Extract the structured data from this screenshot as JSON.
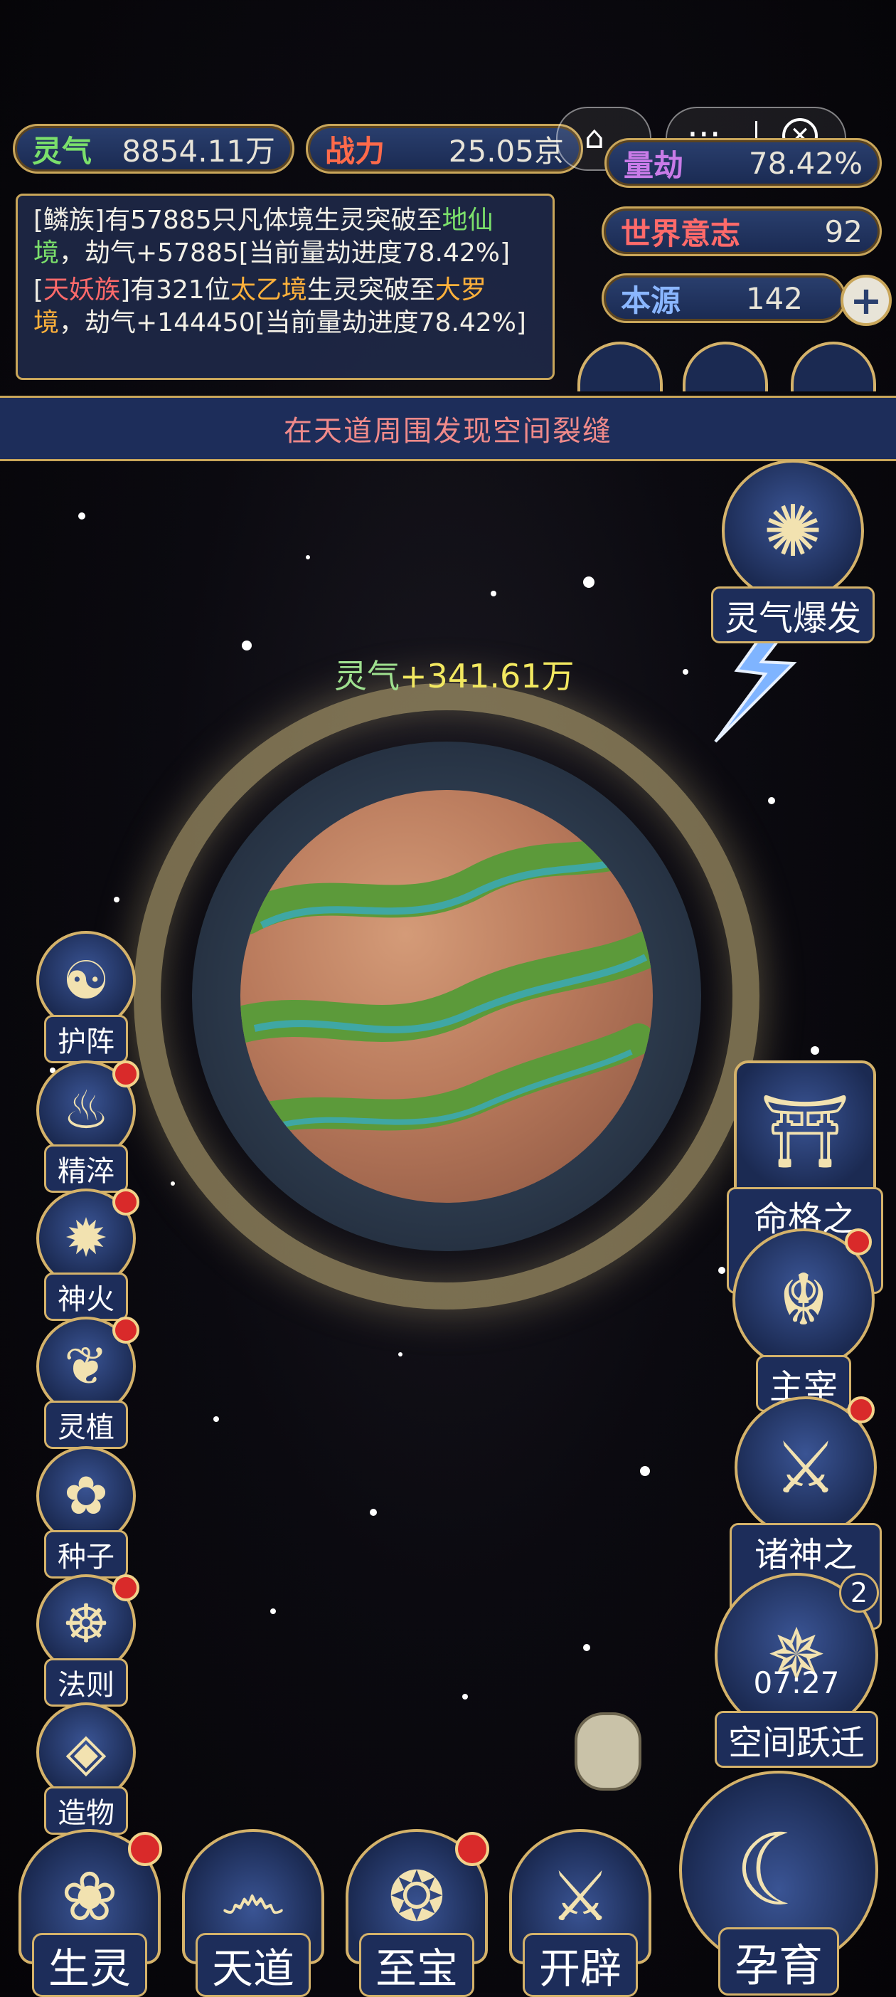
{
  "stats": {
    "lingqi": {
      "label": "灵气",
      "value": "8854.11万"
    },
    "zhanli": {
      "label": "战力",
      "value": "25.05京"
    },
    "liangjie": {
      "label": "量劫",
      "value": "78.42%"
    },
    "world_will": {
      "label": "世界意志",
      "value": "92"
    },
    "origin": {
      "label": "本源",
      "value": "142",
      "plus": "+"
    }
  },
  "log": {
    "line1_prefix": "[鳞族]有57885只凡体境生灵突破至",
    "line1_realm": "地仙境",
    "line1_suffix": "，劫气+57885[当前量劫进度78.42%]",
    "line2_open": "[",
    "line2_clan": "天妖族",
    "line2_mid": "]有321位",
    "line2_realm1": "太乙境",
    "line2_mid2": "生灵突破至",
    "line2_realm2": "大罗境",
    "line2_suffix": "，劫气+144450[当前量劫进度78.42%]"
  },
  "banner": "在天道周围发现空间裂缝",
  "gain": {
    "label": "灵气",
    "value": "+341.61万"
  },
  "left_buttons": [
    {
      "label": "护阵",
      "icon": "yin-yang-icon",
      "glyph": "☯"
    },
    {
      "label": "精淬",
      "icon": "flame-lotus-icon",
      "glyph": "♨"
    },
    {
      "label": "神火",
      "icon": "fire-icon",
      "glyph": "✹"
    },
    {
      "label": "灵植",
      "icon": "plant-icon",
      "glyph": "❦"
    },
    {
      "label": "种子",
      "icon": "seed-flower-icon",
      "glyph": "✿"
    },
    {
      "label": "法则",
      "icon": "rule-beast-icon",
      "glyph": "☸"
    },
    {
      "label": "造物",
      "icon": "rune-diamond-icon",
      "glyph": "◈"
    }
  ],
  "right_buttons": {
    "burst": "灵气爆发",
    "fate": "命格之门",
    "master": "主宰",
    "war": "诸神之战",
    "jump": "空间跃迁",
    "jump_timer": "07:27",
    "jump_badge": "2"
  },
  "bottom_nav": [
    {
      "label": "生灵",
      "icon": "phoenix-icon",
      "glyph": "❀"
    },
    {
      "label": "天道",
      "icon": "swirl-icon",
      "glyph": "෴"
    },
    {
      "label": "至宝",
      "icon": "treasure-icon",
      "glyph": "❂"
    },
    {
      "label": "开辟",
      "icon": "blade-icon",
      "glyph": "⚔"
    }
  ],
  "nurture": {
    "label": "孕育",
    "icon": "cradle-figure-icon",
    "glyph": "☾"
  }
}
